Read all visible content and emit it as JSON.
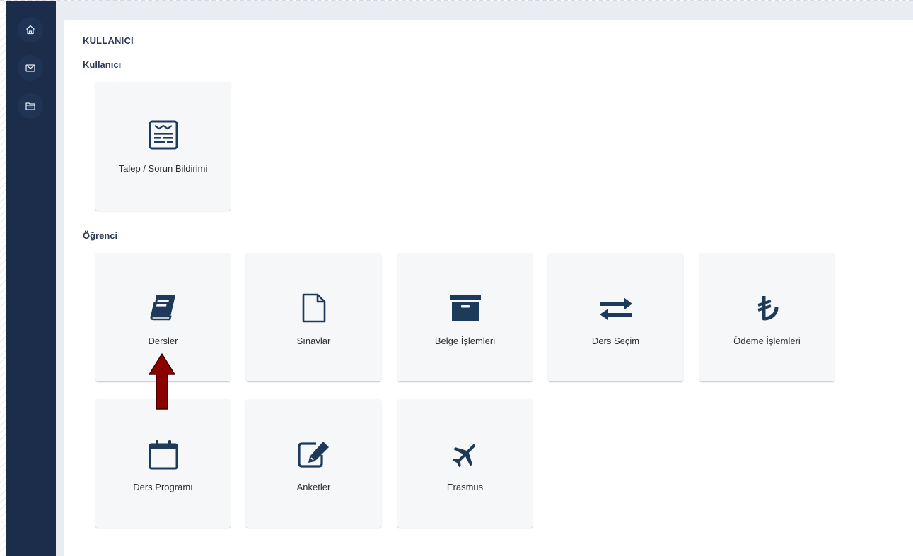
{
  "sidebar": {
    "items": [
      {
        "name": "home",
        "icon": "home-icon"
      },
      {
        "name": "messages",
        "icon": "mail-icon"
      },
      {
        "name": "documents",
        "icon": "folder-icon"
      }
    ]
  },
  "page": {
    "heading": "KULLANICI"
  },
  "sections": {
    "kullanici": {
      "title": "Kullanıcı",
      "tiles": [
        {
          "label": "Talep / Sorun Bildirimi",
          "icon": "newspaper-icon"
        }
      ]
    },
    "ogrenci": {
      "title": "Öğrenci",
      "tiles": [
        {
          "label": "Dersler",
          "icon": "book-icon"
        },
        {
          "label": "Sınavlar",
          "icon": "file-icon"
        },
        {
          "label": "Belge İşlemleri",
          "icon": "archive-icon"
        },
        {
          "label": "Ders Seçim",
          "icon": "exchange-icon"
        },
        {
          "label": "Ödeme İşlemleri",
          "icon": "lira-icon"
        },
        {
          "label": "Ders Programı",
          "icon": "calendar-icon"
        },
        {
          "label": "Anketler",
          "icon": "edit-icon"
        },
        {
          "label": "Erasmus",
          "icon": "plane-icon"
        }
      ]
    }
  },
  "colors": {
    "sidebar": "#1c2d4b",
    "icon": "#1e3a5a",
    "annotation_arrow": "#8b0000"
  }
}
